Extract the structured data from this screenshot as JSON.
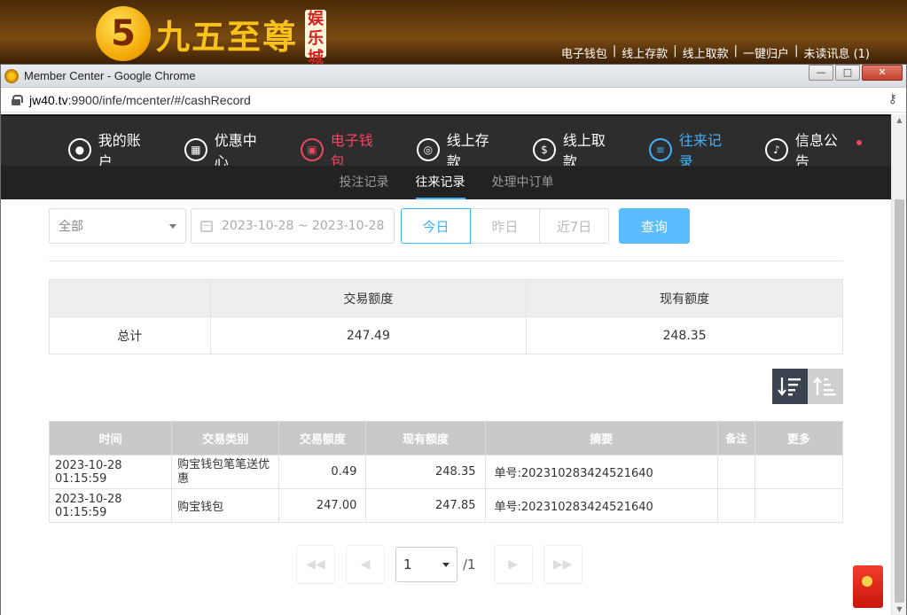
{
  "site": {
    "logo_text": "九五至尊",
    "logo_badge": "娱乐城",
    "top_links": [
      "电子钱包",
      "线上存款",
      "线上取款",
      "一键归户",
      "未读讯息 (1)"
    ]
  },
  "browser": {
    "window_title": "Member Center - Google Chrome",
    "url_host": "jw40.tv",
    "url_rest": ":9900/infe/mcenter/#/cashRecord",
    "buttons": {
      "minimize": "—",
      "maximize": "□",
      "close": "✕"
    }
  },
  "nav": {
    "items": [
      {
        "label": "我的账户",
        "icon": "user-icon"
      },
      {
        "label": "优惠中心",
        "icon": "gift-icon"
      },
      {
        "label": "电子钱包",
        "icon": "wallet-icon",
        "state": "red"
      },
      {
        "label": "线上存款",
        "icon": "deposit-icon"
      },
      {
        "label": "线上取款",
        "icon": "withdraw-icon"
      },
      {
        "label": "往来记录",
        "icon": "record-icon",
        "state": "active"
      },
      {
        "label": "信息公告",
        "icon": "bell-icon",
        "badge_dot": true
      }
    ],
    "sub_items": [
      {
        "label": "投注记录"
      },
      {
        "label": "往来记录",
        "active": true
      },
      {
        "label": "处理中订单"
      }
    ]
  },
  "filters": {
    "category_selected": "全部",
    "date_range": "2023-10-28 ~ 2023-10-28",
    "quick_buttons": [
      "今日",
      "昨日",
      "近7日"
    ],
    "quick_active": "今日",
    "search_label": "查询"
  },
  "summary": {
    "headers": [
      "",
      "交易额度",
      "现有额度"
    ],
    "row_label": "总计",
    "trade_amount": "247.49",
    "current_amount": "248.35"
  },
  "records": {
    "headers": [
      "时间",
      "交易类别",
      "交易额度",
      "现有额度",
      "摘要",
      "备注",
      "更多"
    ],
    "rows": [
      {
        "time": "2023-10-28 01:15:59",
        "type": "购宝钱包笔笔送优惠",
        "amount": "0.49",
        "balance": "248.35",
        "summary": "单号:202310283424521640",
        "note": "",
        "more": ""
      },
      {
        "time": "2023-10-28 01:15:59",
        "type": "购宝钱包",
        "amount": "247.00",
        "balance": "247.85",
        "summary": "单号:202310283424521640",
        "note": "",
        "more": ""
      }
    ]
  },
  "pagination": {
    "current": "1",
    "total": "/1"
  },
  "colors": {
    "accent_blue": "#3fb2ff",
    "accent_red": "#ee4860",
    "nav_bg": "#2d2d2d"
  }
}
